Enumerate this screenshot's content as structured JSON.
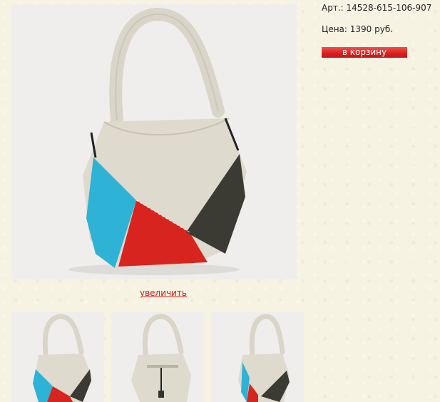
{
  "product": {
    "sku": "Арт.: 14528-615-106-907",
    "price": "Цена: 1390 руб.",
    "add_to_cart_label": "в корзину",
    "zoom_label": "увеличить"
  },
  "colors": {
    "accent_red": "#d8201e",
    "link_red": "#cc1a1a",
    "bag_beige": "#dcd8cb",
    "bag_blue": "#2eb2d6",
    "bag_red": "#d8241f",
    "bag_dark": "#3b3a33"
  },
  "gallery": {
    "thumbnails": [
      "bag-front-photo",
      "bag-back-photo",
      "bag-side-photo"
    ]
  }
}
